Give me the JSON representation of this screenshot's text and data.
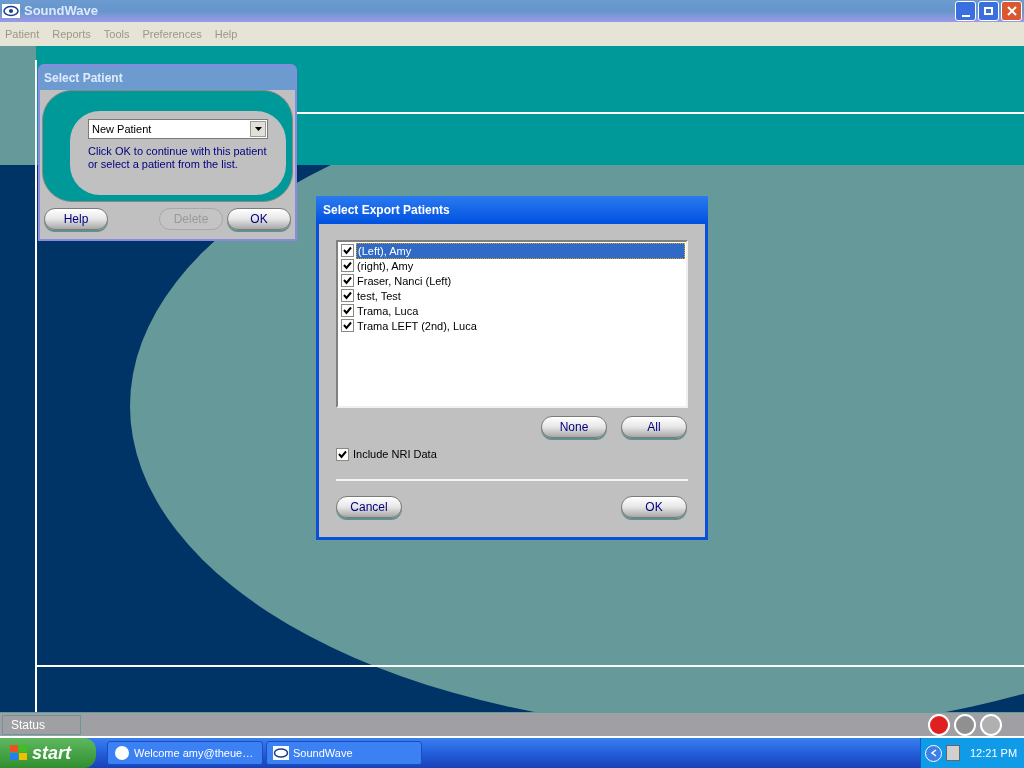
{
  "window": {
    "title": "SoundWave"
  },
  "menu": [
    "Patient",
    "Reports",
    "Tools",
    "Preferences",
    "Help"
  ],
  "select_patient": {
    "title": "Select Patient",
    "dropdown": {
      "value": "New Patient"
    },
    "hint": "Click OK to continue with this patient or select a patient from the list.",
    "buttons": [
      {
        "label": "Help",
        "disabled": false
      },
      {
        "label": "Delete",
        "disabled": true
      },
      {
        "label": "OK",
        "disabled": false
      }
    ]
  },
  "export_dialog": {
    "title": "Select Export Patients",
    "patients": [
      {
        "name": "(Left), Amy",
        "checked": true,
        "selected": true
      },
      {
        "name": "(right), Amy",
        "checked": true,
        "selected": false
      },
      {
        "name": "Fraser, Nanci (Left)",
        "checked": true,
        "selected": false
      },
      {
        "name": "test, Test",
        "checked": true,
        "selected": false
      },
      {
        "name": "Trama, Luca",
        "checked": true,
        "selected": false
      },
      {
        "name": "Trama LEFT (2nd), Luca",
        "checked": true,
        "selected": false
      }
    ],
    "list_buttons": [
      "None",
      "All"
    ],
    "include_nri": {
      "label": "Include NRI Data",
      "checked": true
    },
    "footer_buttons": [
      "Cancel",
      "OK"
    ]
  },
  "status_bar": {
    "label": "Status"
  },
  "taskbar": {
    "start": "start",
    "tasks": [
      {
        "label": "Welcome amy@theue…",
        "kind": "browser"
      },
      {
        "label": "SoundWave",
        "kind": "app"
      }
    ],
    "clock": "12:21 PM"
  }
}
